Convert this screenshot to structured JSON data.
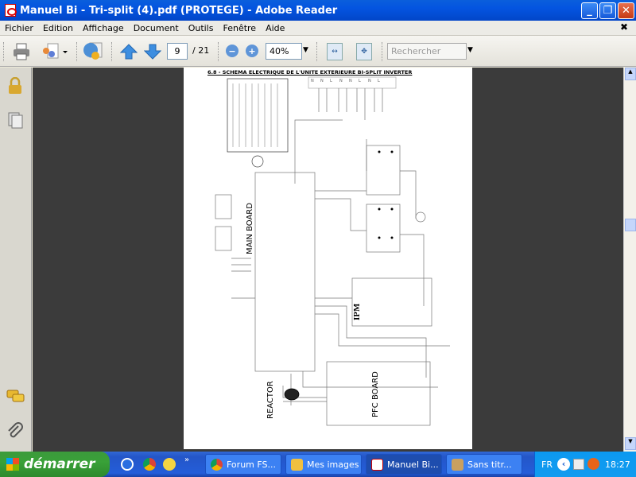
{
  "window": {
    "title": "Manuel Bi - Tri-split (4).pdf (PROTEGE) - Adobe Reader"
  },
  "menu": [
    "Fichier",
    "Edition",
    "Affichage",
    "Document",
    "Outils",
    "Fenêtre",
    "Aide"
  ],
  "toolbar": {
    "page_current": "9",
    "page_total": "/ 21",
    "zoom": "40%",
    "search_placeholder": "Rechercher"
  },
  "document": {
    "heading": "6.8 - SCHEMA ELECTRIQUE DE L'UNITE EXTERIEURE BI-SPLIT INVERTER",
    "labels": {
      "main_board": "MAIN BOARD",
      "ipm": "IPM",
      "reactor": "REACTOR",
      "pfc_board": "PFC BOARD"
    },
    "terminals": [
      "N",
      "N",
      "L",
      "N",
      "N",
      "L",
      "N",
      "L"
    ]
  },
  "taskbar": {
    "start": "démarrer",
    "tasks": [
      {
        "label": "Forum FS..."
      },
      {
        "label": "Mes images"
      },
      {
        "label": "Manuel Bi..."
      },
      {
        "label": "Sans titr..."
      }
    ],
    "lang": "FR",
    "clock": "18:27"
  }
}
